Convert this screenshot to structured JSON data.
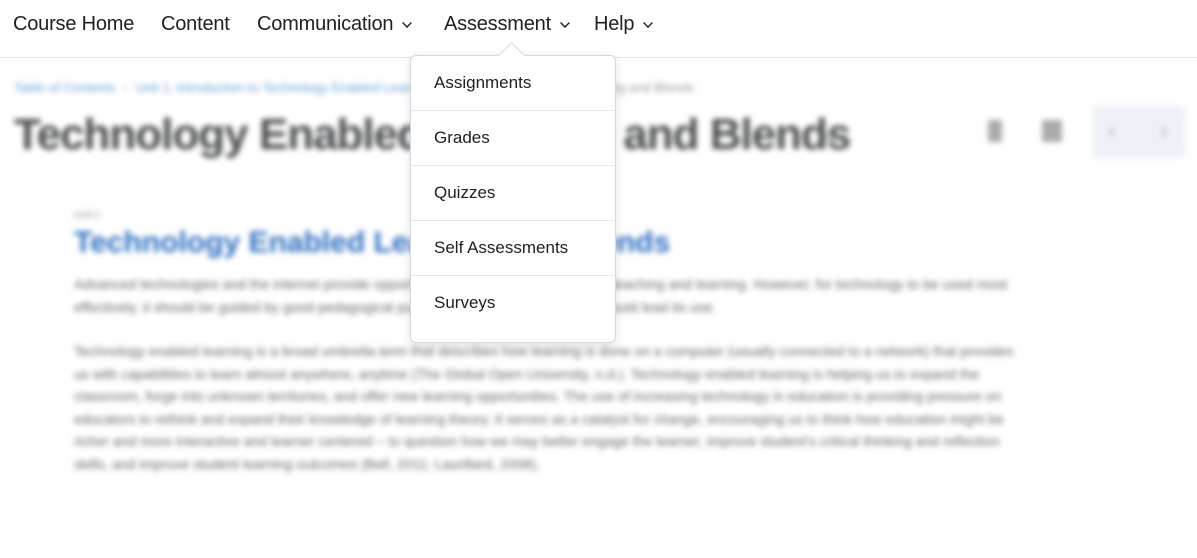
{
  "navbar": {
    "items": [
      {
        "label": "Course Home",
        "has_dropdown": false
      },
      {
        "label": "Content",
        "has_dropdown": false
      },
      {
        "label": "Communication",
        "has_dropdown": true
      },
      {
        "label": "Assessment",
        "has_dropdown": true,
        "open": true
      },
      {
        "label": "Help",
        "has_dropdown": true
      }
    ]
  },
  "assessment_menu": {
    "items": [
      {
        "label": "Assignments"
      },
      {
        "label": "Grades"
      },
      {
        "label": "Quizzes"
      },
      {
        "label": "Self Assessments"
      },
      {
        "label": "Surveys"
      }
    ]
  },
  "background": {
    "breadcrumb": [
      "Table of Contents",
      "Unit 1: Introduction to Technology Enabled Learning",
      "Technology Enabled Learning and Blends"
    ],
    "page_title": "Technology Enabled Learning and Blends",
    "unit_label": "Unit 1",
    "topic_title": "Technology Enabled Learning and Blends",
    "paragraphs": [
      "Advanced technologies and the internet provide opportunities for education to improve teaching and learning. However, for technology to be used most effectively, it should be guided by good pedagogical purpose. Appropriate pedagogy should lead its use.",
      "Technology enabled learning is a broad umbrella term that describes how learning is done on a computer (usually connected to a network) that provides us with capabilities to learn almost anywhere, anytime (The Global Open University, n.d.). Technology enabled learning is helping us to expand the classroom, forge into unknown territories, and offer new learning opportunities. The use of increasing technology in education is providing pressure on educators to rethink and expand their knowledge of learning theory. It serves as a catalyst for change, encouraging us to think how education might be richer and more interactive and learner centered – to question how we may better engage the learner, improve student's critical thinking and reflection skills, and improve student learning outcomes (Bell, 2011; Laurillard, 2008)."
    ]
  }
}
